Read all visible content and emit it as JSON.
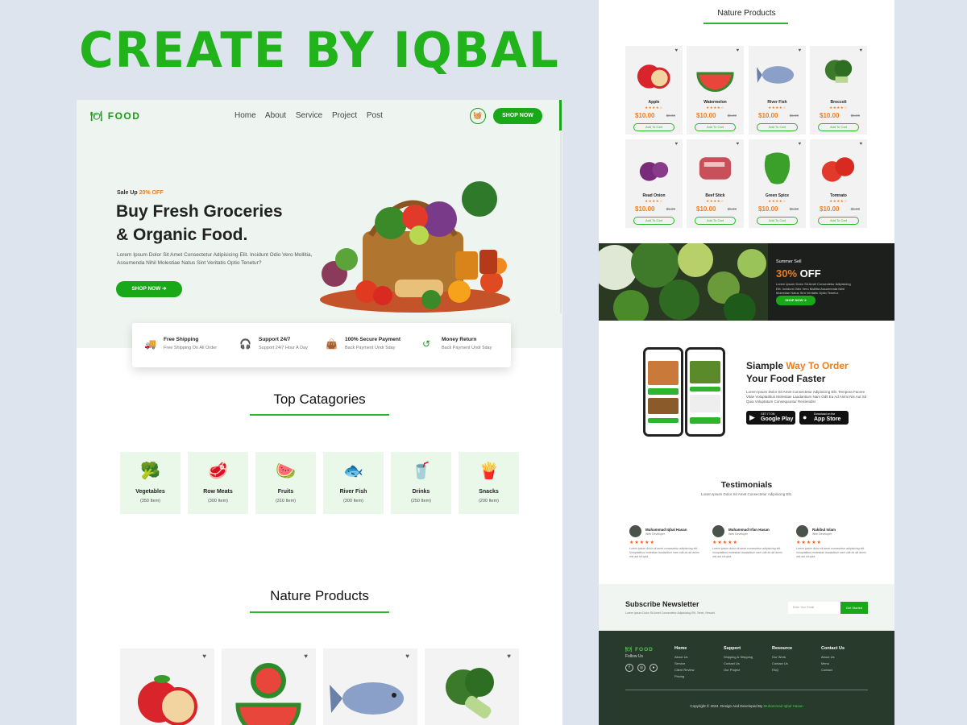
{
  "banner": {
    "title": "CREATE BY IQBAL"
  },
  "left": {
    "nav": {
      "logo": "FOOD",
      "links": [
        "Home",
        "About",
        "Service",
        "Project",
        "Post"
      ],
      "shop_button": "SHOP NOW"
    },
    "hero": {
      "sale_prefix": "Sale Up",
      "sale_value": "20% OFF",
      "headline_line1": "Buy Fresh Groceries",
      "headline_line2": "& Organic Food.",
      "paragraph": "Lorem Ipsum Dolor Sit Amet Consectetur Adipisicing Elit. Incidunt Odio Vero Mollitia, Assumenda Nihil Molestiae Natus Sint Veritatis Optio Tenetur?",
      "button": "SHOP NOW"
    },
    "features": [
      {
        "title": "Free Shipping",
        "subtitle": "Free Shipping On All Order"
      },
      {
        "title": "Support 24/7",
        "subtitle": "Support 24/7 Hour A Day"
      },
      {
        "title": "100% Secure Payment",
        "subtitle": "Back Payment Undr 5day"
      },
      {
        "title": "Money Return",
        "subtitle": "Back Payment Undr 5day"
      }
    ],
    "categories_title": "Top Catagories",
    "categories": [
      {
        "name": "Vegetables",
        "count": "(350 Item)"
      },
      {
        "name": "Row Meats",
        "count": "(300 Item)"
      },
      {
        "name": "Fruits",
        "count": "(310 Item)"
      },
      {
        "name": "River Fish",
        "count": "(300 Item)"
      },
      {
        "name": "Drinks",
        "count": "(250 Item)"
      },
      {
        "name": "Snacks",
        "count": "(200 Item)"
      }
    ],
    "products_title": "Nature Products"
  },
  "right": {
    "products_title": "Nature Products",
    "products": [
      {
        "name": "Apple",
        "stars": "★★★★☆",
        "price": "$10.00",
        "old_price": "$5.00",
        "button": "Add To Cart"
      },
      {
        "name": "Watermelon",
        "stars": "★★★★☆",
        "price": "$10.00",
        "old_price": "$5.00",
        "button": "Add To Cart"
      },
      {
        "name": "River Fish",
        "stars": "★★★★☆",
        "price": "$10.00",
        "old_price": "$5.00",
        "button": "Add To Cart"
      },
      {
        "name": "Broccoli",
        "stars": "★★★★☆",
        "price": "$10.00",
        "old_price": "$5.00",
        "button": "Add To Cart"
      },
      {
        "name": "Read Onion",
        "stars": "★★★★☆",
        "price": "$10.00",
        "old_price": "$5.00",
        "button": "Add To Cart"
      },
      {
        "name": "Beef Stick",
        "stars": "★★★★☆",
        "price": "$10.00",
        "old_price": "$5.00",
        "button": "Add To Cart"
      },
      {
        "name": "Green Spice",
        "stars": "★★★★☆",
        "price": "$10.00",
        "old_price": "$5.00",
        "button": "Add To Cart"
      },
      {
        "name": "Tomnato",
        "stars": "★★★★☆",
        "price": "$10.00",
        "old_price": "$5.00",
        "button": "Add To Cart"
      }
    ],
    "promo": {
      "label": "Summer Sell",
      "discount": "30%",
      "discount_suffix": "OFF",
      "text": "Lorem Ipsum Dolor Sit Amet Consectetur Adipisicing Elit. Incidunt Odio Vero Mollitia Assumenda Nihil Molestiae Natus Sint Veritatis Optio Tenetur.",
      "button": "SHOP NOW"
    },
    "app": {
      "title_prefix": "Siample",
      "title_highlight": "Way To Order",
      "title_line2": "Your Food Faster",
      "paragraph": "Lorem Ipsum Dolor Sit Amet Consectetur Adipisicing Elit. Tempora Facere Vitae Voluptatibus Molestiae Laudantium Nam Odit Ea Ad Animi Nis Aut Sit Quia Voluptatum Consequuntur Reiciendis!",
      "google": {
        "top": "GET IT ON",
        "bottom": "Google Play"
      },
      "apple": {
        "top": "Download on the",
        "bottom": "App Store"
      }
    },
    "testimonials": {
      "title": "Testimonials",
      "subtitle": "Lorem Ipsum Dolor Sit Amet Consectetur Adipisicing Elit.",
      "items": [
        {
          "name": "Muhammad Iqbal Hasan",
          "role": "Web Developer",
          "stars": "★★★★★",
          "text": "Lorem ipsum dolor sit amet consectetur adipisicing elit. Voluptatibus molestiae laudantium nam odit ea ad animi nisi aut sit quia."
        },
        {
          "name": "Muhammad Irfan Hasan",
          "role": "Web Developer",
          "stars": "★★★★★",
          "text": "Lorem ipsum dolor sit amet consectetur adipisicing elit. Voluptatibus molestiae laudantium nam odit ea ad animi nisi aut sit quia."
        },
        {
          "name": "Rakibul Islam",
          "role": "Web Developer",
          "stars": "★★★★★",
          "text": "Lorem ipsum dolor sit amet consectetur adipisicing elit. Voluptatibus molestiae laudantium nam odit ea ad animi nisi aut sit quia."
        }
      ]
    },
    "newsletter": {
      "title": "Subscribe Newsletter",
      "subtitle": "Lorem Ipsum Dolor Sit Amet Consectetur Adipisicing Elit. Tenet, Nesum!",
      "placeholder": "Enter Your Email",
      "button": "Get Started"
    },
    "footer": {
      "logo": "FOOD",
      "follow": "Follow Us",
      "columns": [
        {
          "heading": "Home",
          "items": [
            "About Us",
            "Service",
            "Client Review",
            "Pricing"
          ]
        },
        {
          "heading": "Support",
          "items": [
            "Shipping & Shipping",
            "Contact Us",
            "Our Project"
          ]
        },
        {
          "heading": "Resource",
          "items": [
            "Our Work",
            "Contact Us",
            "FAQ"
          ]
        },
        {
          "heading": "Contact Us",
          "items": [
            "About Us",
            "Menu",
            "Contact"
          ]
        }
      ],
      "copyright": "Copyright © 2024. Design And Developed By",
      "author": "Muhammad Iqbal Hasan"
    }
  },
  "colors": {
    "accent": "#18a818",
    "orange": "#f07c1c",
    "footer": "#283a2c"
  }
}
